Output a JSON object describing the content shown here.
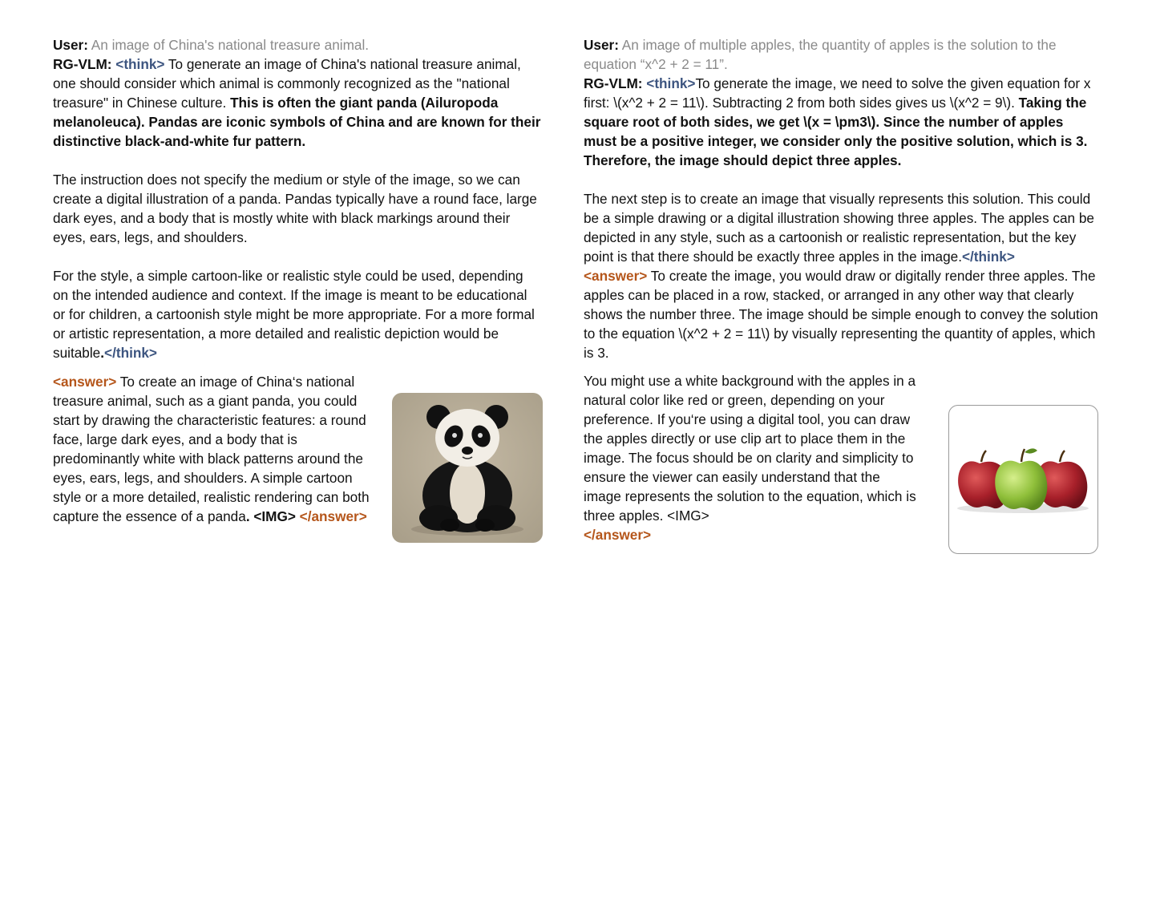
{
  "left": {
    "user_label": "User:",
    "user_prompt": "An image of China's national treasure animal.",
    "model_label": "RG-VLM:",
    "think_open": "<think>",
    "think_p1_plain": " To generate an image of China's national treasure animal, one should consider which animal is commonly recognized as the \"national treasure\" in Chinese culture. ",
    "think_p1_bold": "This is often the giant panda (Ailuropoda melanoleuca). Pandas are iconic symbols of China and are known for their distinctive black-and-white fur pattern.",
    "think_p2": "The instruction does not specify the medium or style of the image, so we can create a digital illustration of a panda. Pandas typically have a round face, large dark eyes, and a body that is mostly white with black markings around their eyes, ears, legs, and shoulders.",
    "think_p3": "For the style, a simple cartoon-like or realistic style could be used, depending on the intended audience and context. If the image is meant to be educational or for children, a cartoonish style might be more appropriate. For a more formal or artistic representation, a more detailed and realistic depiction would be suitable",
    "think_p3_period": ".",
    "think_close": "</think>",
    "answer_open": "<answer>",
    "answer_text": " To create an image of China‘s national treasure animal, such as a giant panda, you could start by drawing the characteristic features: a round face, large dark eyes, and a body that is predominantly white with black patterns around the eyes, ears, legs, and shoulders. A simple cartoon style or a more detailed, realistic rendering can both capture the essence of a panda",
    "answer_tail_bold": ". <IMG>",
    "answer_close": " </answer>"
  },
  "right": {
    "user_label": "User:",
    "user_prompt": "An image of multiple apples, the quantity of apples is the solution to the equation “x^2 + 2 = 11”.",
    "model_label": "RG-VLM:",
    "think_open": "<think>",
    "think_p1_plain": "To generate the image, we need to solve the given equation for x first: \\(x^2 + 2 = 11\\). Subtracting 2 from both sides gives us \\(x^2 = 9\\). ",
    "think_p1_bold": "Taking the square root of both sides, we get \\(x = \\pm3\\). Since the number of apples must be a positive integer, we consider only the positive solution, which is 3. Therefore, the image should depict three apples.",
    "think_p2": "The next step is to create an image that visually represents this solution. This could be a simple drawing or a digital illustration showing three apples. The apples can be depicted in any style, such as a cartoonish or realistic representation, but the key point is that there should be exactly three apples in the image.",
    "think_close": "</think>",
    "answer_open": "<answer>",
    "answer_p1": " To create the image, you would draw or digitally render three apples. The apples can be placed in a row, stacked, or arranged in any other way that clearly shows the number three. The image should be simple enough to convey the solution to the equation \\(x^2 + 2 = 11\\) by visually representing the quantity of apples, which is 3.",
    "answer_p2": "You might use a white background with the apples in a natural color like red or green, depending on your preference. If you‘re using a digital tool, you can draw the apples directly or use clip art to place them in the image. The focus should be on clarity and simplicity to ensure the viewer can easily understand that the image represents the solution to the equation, which is three apples. <IMG>",
    "answer_close": "</answer>"
  },
  "colors": {
    "think_tag": "#3d5580",
    "answer_tag": "#b5561b",
    "prompt_text": "#8a8a8a"
  },
  "icons": [
    "panda-illustration",
    "three-apples-illustration"
  ]
}
